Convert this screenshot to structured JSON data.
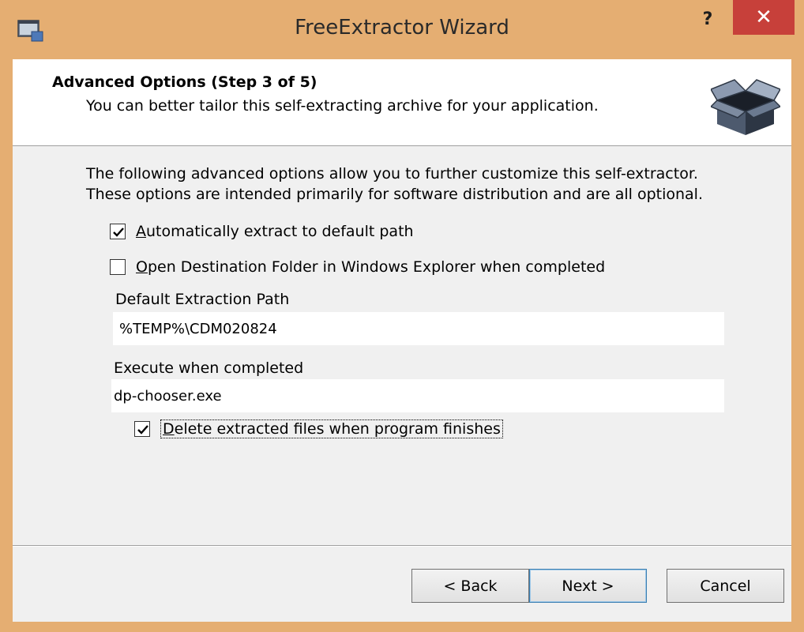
{
  "window": {
    "title": "FreeExtractor Wizard",
    "help_glyph": "?",
    "close_glyph": "✕",
    "icon": "window-app-icon"
  },
  "header": {
    "title": "Advanced Options (Step 3 of 5)",
    "subtitle": "You can better tailor this self-extracting archive for your application.",
    "icon": "box-icon"
  },
  "intro": {
    "line1": "The following advanced options allow you to further customize this self-extractor.",
    "line2": "These options are intended primarily for software distribution and are all optional."
  },
  "options": {
    "auto_extract": {
      "label": "Automatically extract to default path",
      "checked": true
    },
    "open_folder": {
      "label": "Open Destination Folder in Windows Explorer when completed",
      "checked": false
    },
    "delete_files": {
      "label": "Delete extracted files when program finishes",
      "checked": true
    }
  },
  "fields": {
    "path_label": "Default Extraction Path",
    "path_value": "%TEMP%\\CDM020824",
    "exec_label": "Execute when completed",
    "exec_value": "dp-chooser.exe"
  },
  "buttons": {
    "back": "< Back",
    "next": "Next >",
    "cancel": "Cancel"
  },
  "colors": {
    "frame": "#e5ae72",
    "close": "#c7403a",
    "client": "#f0f0f0"
  }
}
